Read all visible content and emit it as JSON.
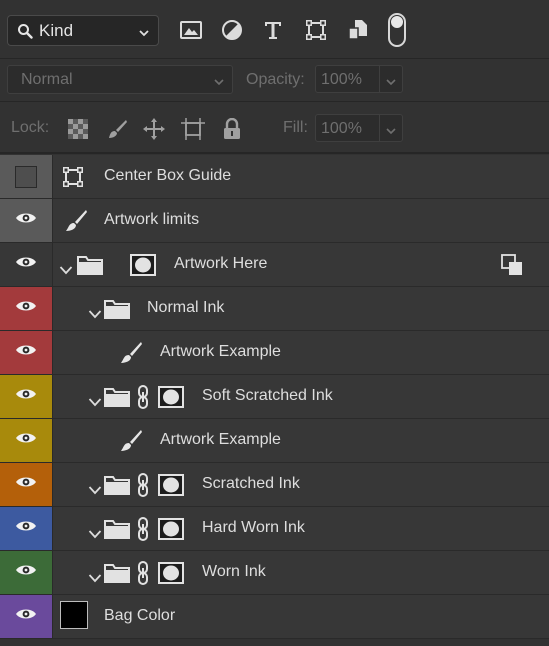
{
  "filter": {
    "kind_label": "Kind",
    "icons": [
      "image-filter-icon",
      "adjustment-filter-icon",
      "type-filter-icon",
      "shape-filter-icon",
      "smart-object-filter-icon"
    ]
  },
  "blend": {
    "mode": "Normal",
    "opacity_label": "Opacity:",
    "opacity_value": "100%"
  },
  "lock": {
    "label": "Lock:",
    "fill_label": "Fill:",
    "fill_value": "100%"
  },
  "layers": [
    {
      "name": "Center Box Guide",
      "visible": false,
      "color": "#5a5a5a",
      "indent": 0,
      "type": "shape"
    },
    {
      "name": "Artwork limits",
      "visible": true,
      "color": "#5a5a5a",
      "indent": 0,
      "type": "brush"
    },
    {
      "name": "Artwork Here",
      "visible": true,
      "color": "#373737",
      "indent": 0,
      "type": "group-mask"
    },
    {
      "name": "Normal Ink",
      "visible": true,
      "color": "#a33a3c",
      "indent": 1,
      "type": "group"
    },
    {
      "name": "Artwork Example",
      "visible": true,
      "color": "#a33a3c",
      "indent": 2,
      "type": "brush"
    },
    {
      "name": "Soft Scratched Ink",
      "visible": true,
      "color": "#a88a0c",
      "indent": 1,
      "type": "group-link-mask"
    },
    {
      "name": "Artwork Example",
      "visible": true,
      "color": "#a88a0c",
      "indent": 2,
      "type": "brush"
    },
    {
      "name": "Scratched Ink",
      "visible": true,
      "color": "#b4600a",
      "indent": 1,
      "type": "group-link-mask"
    },
    {
      "name": "Hard Worn Ink",
      "visible": true,
      "color": "#3d5aa0",
      "indent": 1,
      "type": "group-link-mask"
    },
    {
      "name": "Worn Ink",
      "visible": true,
      "color": "#3c6b38",
      "indent": 1,
      "type": "group-link-mask"
    },
    {
      "name": "Bag Color",
      "visible": true,
      "color": "#6a4a9c",
      "indent": 0,
      "type": "fill"
    }
  ],
  "colors": {
    "panel": "#323232",
    "row": "#373737",
    "text": "#dedede"
  }
}
